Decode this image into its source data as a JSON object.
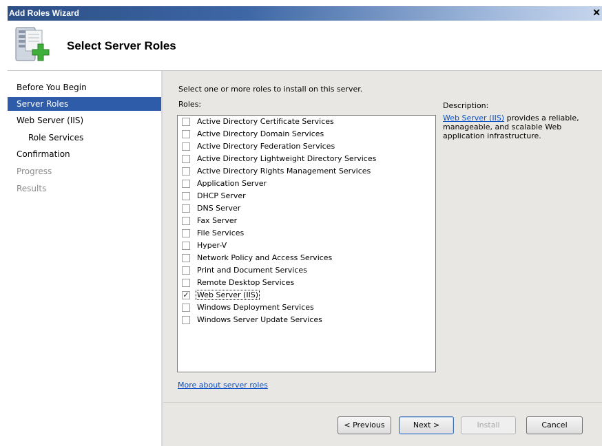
{
  "window": {
    "title": "Add Roles Wizard",
    "close_glyph": "✕"
  },
  "header": {
    "title": "Select Server Roles",
    "icon": "server-add-icon"
  },
  "nav": [
    {
      "label": "Before You Begin",
      "state": "normal"
    },
    {
      "label": "Server Roles",
      "state": "selected"
    },
    {
      "label": "Web Server (IIS)",
      "state": "normal"
    },
    {
      "label": "Role Services",
      "state": "sub"
    },
    {
      "label": "Confirmation",
      "state": "normal"
    },
    {
      "label": "Progress",
      "state": "disabled"
    },
    {
      "label": "Results",
      "state": "disabled"
    }
  ],
  "main": {
    "instruction": "Select one or more roles to install on this server.",
    "roles_label": "Roles:",
    "roles": [
      {
        "label": "Active Directory Certificate Services",
        "checked": false
      },
      {
        "label": "Active Directory Domain Services",
        "checked": false
      },
      {
        "label": "Active Directory Federation Services",
        "checked": false
      },
      {
        "label": "Active Directory Lightweight Directory Services",
        "checked": false
      },
      {
        "label": "Active Directory Rights Management Services",
        "checked": false
      },
      {
        "label": "Application Server",
        "checked": false
      },
      {
        "label": "DHCP Server",
        "checked": false
      },
      {
        "label": "DNS Server",
        "checked": false
      },
      {
        "label": "Fax Server",
        "checked": false
      },
      {
        "label": "File Services",
        "checked": false
      },
      {
        "label": "Hyper-V",
        "checked": false
      },
      {
        "label": "Network Policy and Access Services",
        "checked": false
      },
      {
        "label": "Print and Document Services",
        "checked": false
      },
      {
        "label": "Remote Desktop Services",
        "checked": false
      },
      {
        "label": "Web Server (IIS)",
        "checked": true,
        "selected": true
      },
      {
        "label": "Windows Deployment Services",
        "checked": false
      },
      {
        "label": "Windows Server Update Services",
        "checked": false
      }
    ],
    "more_link": "More about server roles",
    "description_label": "Description:",
    "description_link": "Web Server (IIS)",
    "description_text": " provides a reliable, manageable, and scalable Web application infrastructure."
  },
  "buttons": {
    "previous": "< Previous",
    "next": "Next >",
    "install": "Install",
    "cancel": "Cancel"
  },
  "colors": {
    "selection": "#2f5ca8",
    "link": "#0b4fc4",
    "panel": "#e9e7e3"
  }
}
